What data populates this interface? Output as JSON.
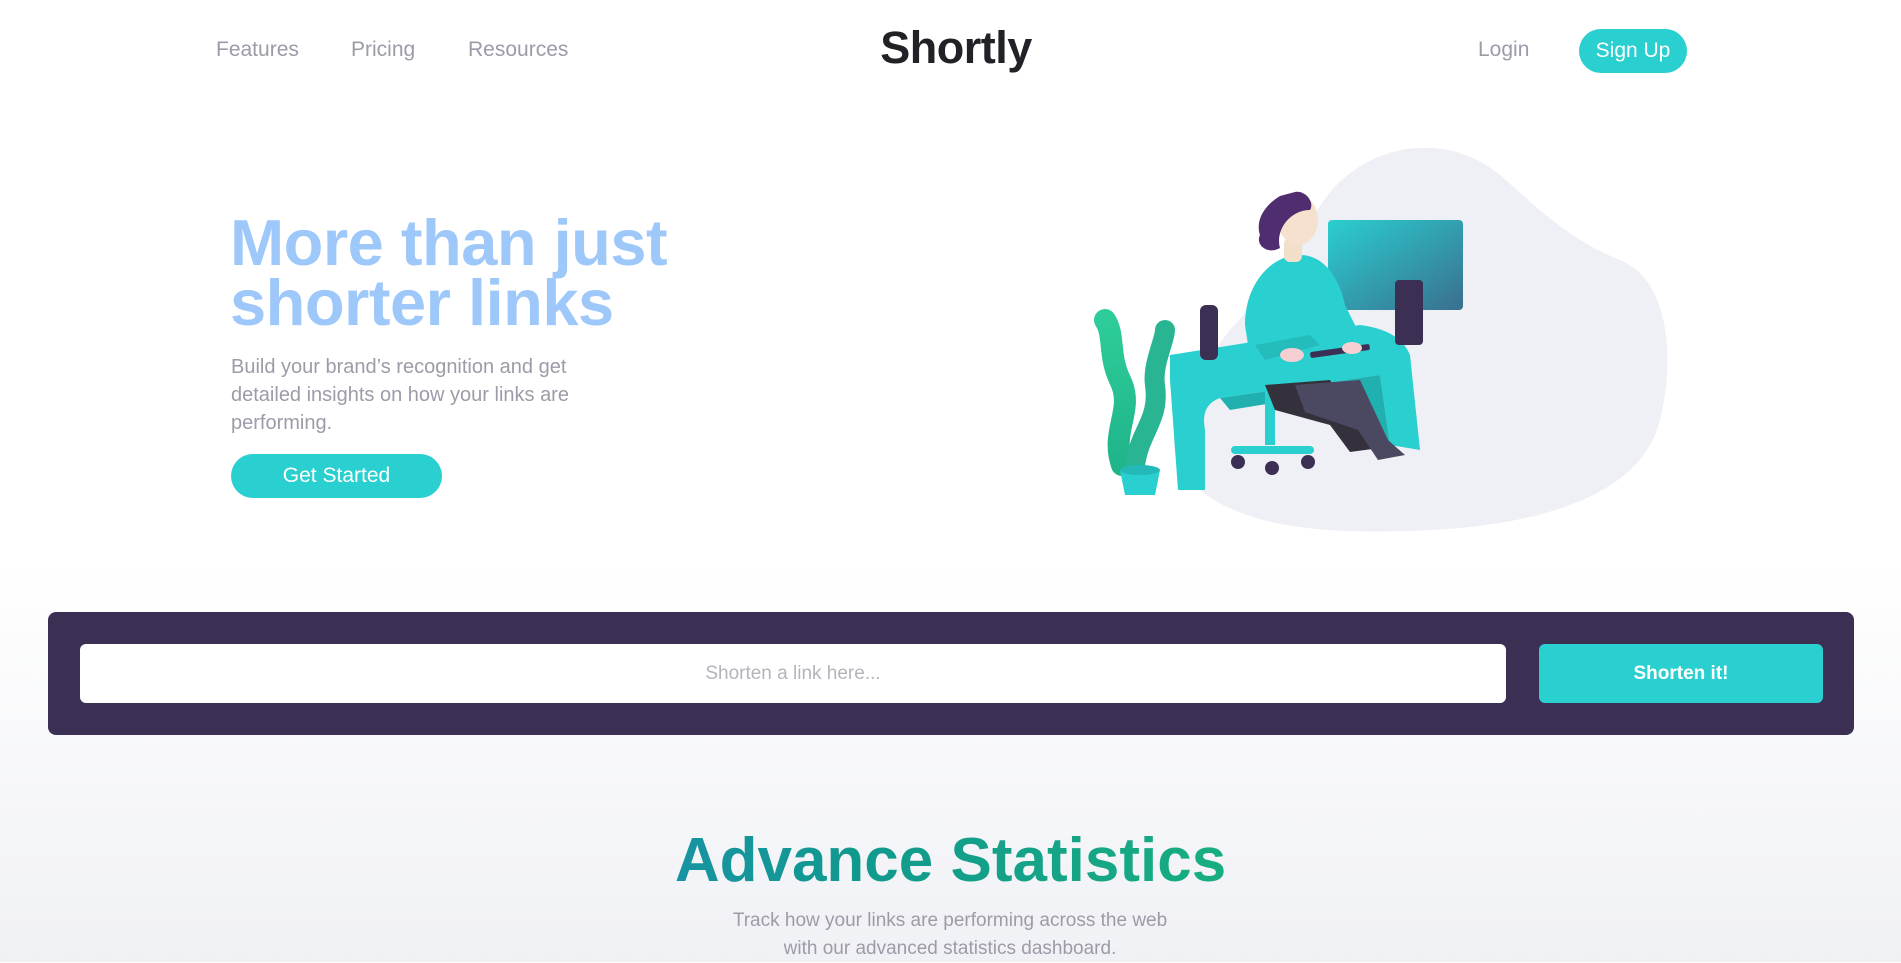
{
  "header": {
    "nav": [
      "Features",
      "Pricing",
      "Resources"
    ],
    "logo": "Shortly",
    "login_label": "Login",
    "signup_label": "Sign Up"
  },
  "hero": {
    "title_line1": "More than just",
    "title_line2": "shorter links",
    "subtitle": "Build your brand’s recognition and get detailed insights on how your links are performing.",
    "cta_label": "Get Started"
  },
  "shortener": {
    "placeholder": "Shorten a link here...",
    "value": "",
    "button_label": "Shorten it!"
  },
  "statistics": {
    "title_word1": "Advance",
    "title_word2": "Statistics",
    "description": "Track how your links are performing across the web with our advanced statistics dashboard."
  },
  "colors": {
    "accent": "#2acfcf",
    "panel": "#3b3054",
    "hero_title": "#9dc8f9",
    "body_text": "#9e9aa8",
    "logo": "#232127"
  }
}
